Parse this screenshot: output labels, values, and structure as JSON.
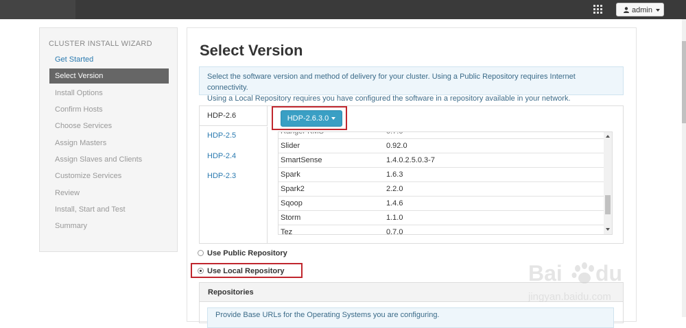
{
  "header": {
    "admin_label": "admin",
    "icons": [
      "grid-icon",
      "user-icon",
      "chevron-down-icon"
    ]
  },
  "sidebar": {
    "title": "CLUSTER INSTALL WIZARD",
    "items": [
      {
        "label": "Get Started",
        "state": "done"
      },
      {
        "label": "Select Version",
        "state": "active"
      },
      {
        "label": "Install Options",
        "state": "pending"
      },
      {
        "label": "Confirm Hosts",
        "state": "pending"
      },
      {
        "label": "Choose Services",
        "state": "pending"
      },
      {
        "label": "Assign Masters",
        "state": "pending"
      },
      {
        "label": "Assign Slaves and Clients",
        "state": "pending"
      },
      {
        "label": "Customize Services",
        "state": "pending"
      },
      {
        "label": "Review",
        "state": "pending"
      },
      {
        "label": "Install, Start and Test",
        "state": "pending"
      },
      {
        "label": "Summary",
        "state": "pending"
      }
    ]
  },
  "main": {
    "title": "Select Version",
    "info_line1": "Select the software version and method of delivery for your cluster. Using a Public Repository requires Internet connectivity.",
    "info_line2": "Using a Local Repository requires you have configured the software in a repository available in your network.",
    "tabs": [
      {
        "label": "HDP-2.6",
        "active": true
      },
      {
        "label": "HDP-2.5",
        "active": false
      },
      {
        "label": "HDP-2.4",
        "active": false
      },
      {
        "label": "HDP-2.3",
        "active": false
      }
    ],
    "version_button": "HDP-2.6.3.0",
    "services": [
      {
        "name": "Slider",
        "version": "0.92.0"
      },
      {
        "name": "SmartSense",
        "version": "1.4.0.2.5.0.3-7"
      },
      {
        "name": "Spark",
        "version": "1.6.3"
      },
      {
        "name": "Spark2",
        "version": "2.2.0"
      },
      {
        "name": "Sqoop",
        "version": "1.4.6"
      },
      {
        "name": "Storm",
        "version": "1.1.0"
      },
      {
        "name": "Tez",
        "version": "0.7.0"
      }
    ],
    "repo_options": [
      {
        "label": "Use Public Repository",
        "checked": false
      },
      {
        "label": "Use Local Repository",
        "checked": true
      }
    ],
    "repositories": {
      "title": "Repositories",
      "note": "Provide Base URLs for the Operating Systems you are configuring."
    }
  },
  "colors": {
    "accent": "#3a9fc4",
    "link": "#2a7ab0",
    "highlight_box": "#c0262d",
    "topbar": "#3a3a3a"
  }
}
